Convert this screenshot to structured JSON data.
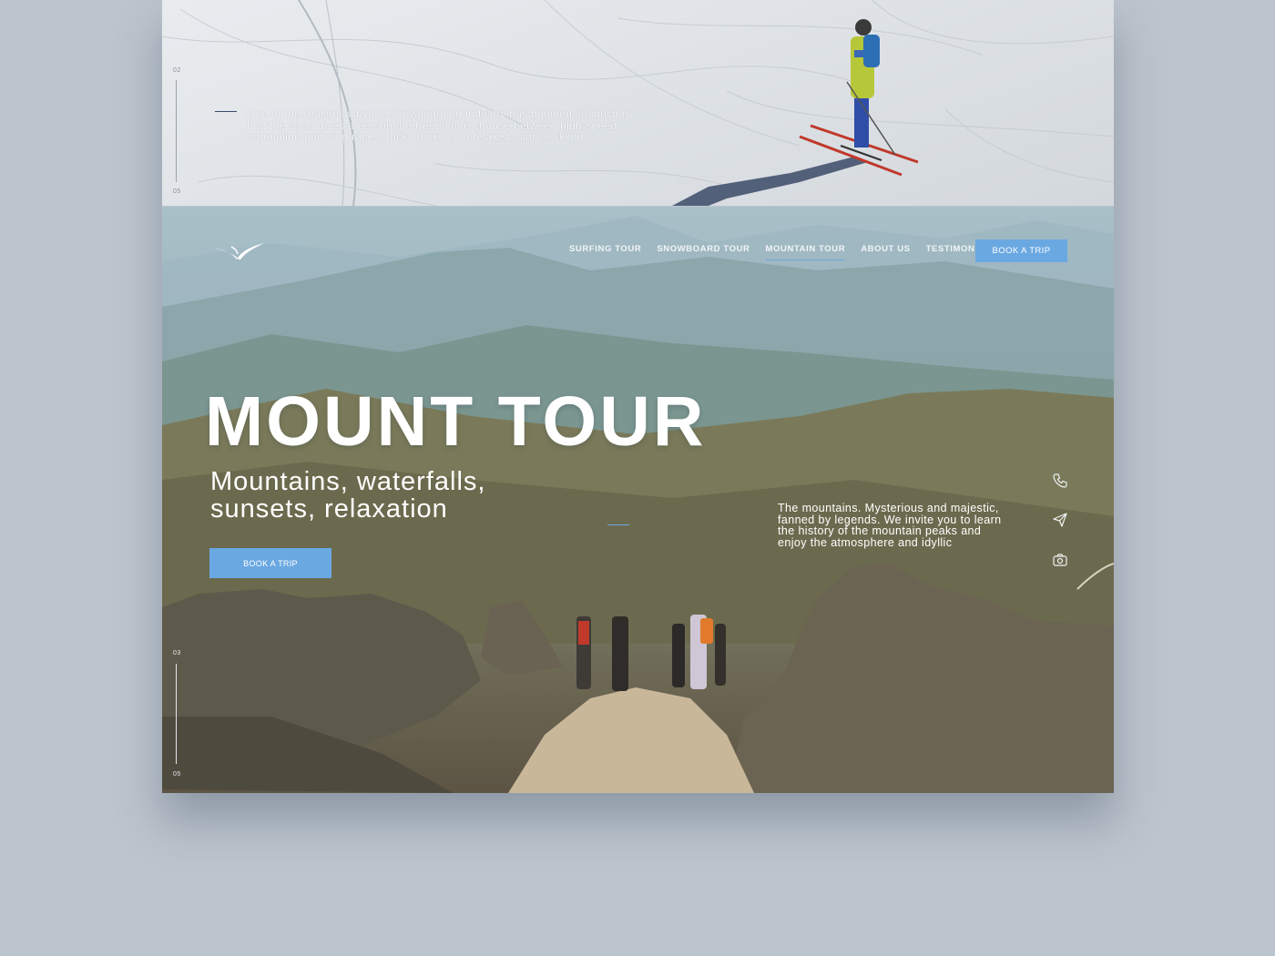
{
  "snow_section": {
    "slide_start": "02",
    "slide_end": "05",
    "text": "One of the reasons why the snowboarding industry has boomed so much is that the sport gives a person the freedom to choose between high-speed, adrenaline-pumping races, tricky tricks, and relaxed, simple skiing."
  },
  "header": {
    "logo_icon": "bird-wing-logo",
    "nav": [
      {
        "label": "SURFING TOUR"
      },
      {
        "label": "SNOWBOARD TOUR"
      },
      {
        "label": "MOUNTAIN TOUR"
      },
      {
        "label": "ABOUT US"
      },
      {
        "label": "TESTIMONIALS"
      }
    ],
    "active_nav": "MOUNTAIN TOUR",
    "cta_label": "BOOK A TRIP"
  },
  "hero": {
    "title": "MOUNT TOUR",
    "subtitle": "Mountains, waterfalls, sunsets, relaxation",
    "cta_label": "BOOK A TRIP",
    "description": "The mountains. Mysterious and majestic, fanned by legends. We invite you to learn the history of the mountain peaks and enjoy the atmosphere and idyllic",
    "slide_start": "03",
    "slide_end": "05",
    "side_icons": [
      "phone-icon",
      "send-icon",
      "camera-icon"
    ]
  },
  "colors": {
    "accent": "#6aa8e2",
    "page_background": "#bcc4cd"
  }
}
